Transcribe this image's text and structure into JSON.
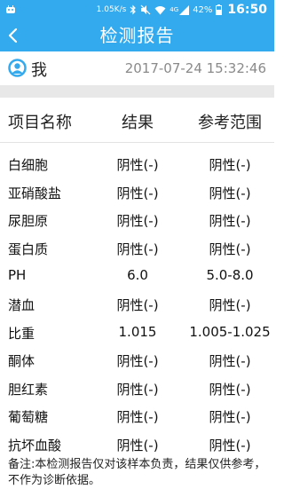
{
  "status_bar": {
    "speed": "1.05K/s",
    "network": "4G",
    "battery": "42%",
    "time": "16:50"
  },
  "header": {
    "title": "检测报告"
  },
  "user": {
    "name": "我",
    "timestamp": "2017-07-24 15:32:46"
  },
  "table": {
    "headers": [
      "项目名称",
      "结果",
      "参考范围"
    ],
    "rows": [
      {
        "name": "白细胞",
        "result": "阴性(-)",
        "range": "阴性(-)"
      },
      {
        "name": "亚硝酸盐",
        "result": "阴性(-)",
        "range": "阴性(-)"
      },
      {
        "name": "尿胆原",
        "result": "阴性(-)",
        "range": "阴性(-)"
      },
      {
        "name": "蛋白质",
        "result": "阴性(-)",
        "range": "阴性(-)"
      },
      {
        "name": "PH",
        "result": "6.0",
        "range": "5.0-8.0"
      },
      {
        "name": "潜血",
        "result": "阴性(-)",
        "range": "阴性(-)"
      },
      {
        "name": "比重",
        "result": "1.015",
        "range": "1.005-1.025"
      },
      {
        "name": "酮体",
        "result": "阴性(-)",
        "range": "阴性(-)"
      },
      {
        "name": "胆红素",
        "result": "阴性(-)",
        "range": "阴性(-)"
      },
      {
        "name": "葡萄糖",
        "result": "阴性(-)",
        "range": "阴性(-)"
      },
      {
        "name": "抗坏血酸",
        "result": "阴性(-)",
        "range": "阴性(-)"
      }
    ]
  },
  "note": "备注:本检测报告仅对该样本负责，结果仅供参考，不作为诊断依据。",
  "colors": {
    "primary": "#33a9ee",
    "divider": "#e8e8e8"
  }
}
